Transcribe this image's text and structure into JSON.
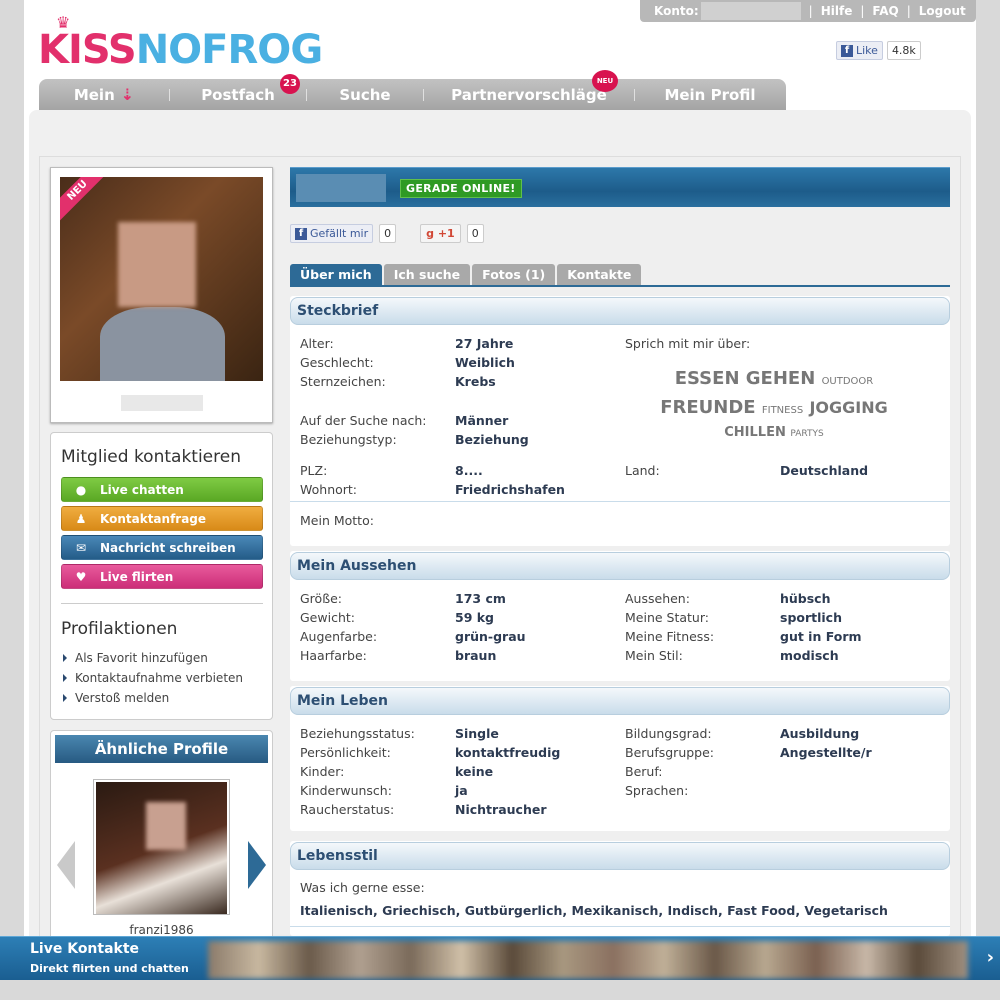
{
  "topbar": {
    "konto": "Konto:",
    "help": "Hilfe",
    "faq": "FAQ",
    "logout": "Logout"
  },
  "logo": {
    "kiss": "KISS",
    "nofrog": "NOFROG"
  },
  "facebook": {
    "like": "Like",
    "count": "4.8k"
  },
  "nav": {
    "items": [
      {
        "label": "Mein"
      },
      {
        "label": "Postfach",
        "badge": "23"
      },
      {
        "label": "Suche"
      },
      {
        "label": "Partnervorschläge",
        "badge": "NEU"
      },
      {
        "label": "Mein Profil"
      }
    ]
  },
  "profile": {
    "neu_ribbon": "NEU",
    "online_badge": "GERADE ONLINE!"
  },
  "social": {
    "fb_like": "Gefällt mir",
    "fb_count": "0",
    "gplus": "+1",
    "gplus_count": "0"
  },
  "contact": {
    "title": "Mitglied kontaktieren",
    "buttons": [
      {
        "label": "Live chatten",
        "color": "#6ab82e"
      },
      {
        "label": "Kontaktanfrage",
        "color": "#e09a2c"
      },
      {
        "label": "Nachricht schreiben",
        "color": "#2d6a96"
      },
      {
        "label": "Live flirten",
        "color": "#d93b86"
      }
    ],
    "actions_title": "Profilaktionen",
    "actions": [
      "Als Favorit hinzufügen",
      "Kontaktaufnahme verbieten",
      "Verstoß melden"
    ]
  },
  "similar": {
    "title": "Ähnliche Profile",
    "name": "franzi1986"
  },
  "tabs": [
    "Über mich",
    "Ich suche",
    "Fotos (1)",
    "Kontakte"
  ],
  "steckbrief": {
    "title": "Steckbrief",
    "alter_l": "Alter:",
    "alter_v": "27 Jahre",
    "geschlecht_l": "Geschlecht:",
    "geschlecht_v": "Weiblich",
    "stern_l": "Sternzeichen:",
    "stern_v": "Krebs",
    "suche_l": "Auf der Suche nach:",
    "suche_v": "Männer",
    "bez_l": "Beziehungstyp:",
    "bez_v": "Beziehung",
    "plz_l": "PLZ:",
    "plz_v": "8....",
    "wohn_l": "Wohnort:",
    "wohn_v": "Friedrichshafen",
    "land_l": "Land:",
    "land_v": "Deutschland",
    "sprich_l": "Sprich mit mir über:",
    "motto_l": "Mein Motto:",
    "cloud": {
      "essen": "ESSEN GEHEN",
      "outdoor": "OUTDOOR",
      "freunde": "FREUNDE",
      "fitness": "FITNESS",
      "jogging": "JOGGING",
      "chillen": "CHILLEN",
      "partys": "PARTYS"
    }
  },
  "aussehen": {
    "title": "Mein Aussehen",
    "groesse_l": "Größe:",
    "groesse_v": "173 cm",
    "gewicht_l": "Gewicht:",
    "gewicht_v": "59 kg",
    "augen_l": "Augenfarbe:",
    "augen_v": "grün-grau",
    "haar_l": "Haarfarbe:",
    "haar_v": "braun",
    "aussehen_l": "Aussehen:",
    "aussehen_v": "hübsch",
    "statur_l": "Meine Statur:",
    "statur_v": "sportlich",
    "fitness_l": "Meine Fitness:",
    "fitness_v": "gut in Form",
    "stil_l": "Mein Stil:",
    "stil_v": "modisch"
  },
  "leben": {
    "title": "Mein Leben",
    "status_l": "Beziehungsstatus:",
    "status_v": "Single",
    "pers_l": "Persönlichkeit:",
    "pers_v": "kontaktfreudig",
    "kinder_l": "Kinder:",
    "kinder_v": "keine",
    "wunsch_l": "Kinderwunsch:",
    "wunsch_v": "ja",
    "raucher_l": "Raucherstatus:",
    "raucher_v": "Nichtraucher",
    "bildung_l": "Bildungsgrad:",
    "bildung_v": "Ausbildung",
    "beruf_grp_l": "Berufsgruppe:",
    "beruf_grp_v": "Angestellte/r",
    "beruf_l": "Beruf:",
    "sprachen_l": "Sprachen:"
  },
  "lebensstil": {
    "title": "Lebensstil",
    "esse_l": "Was ich gerne esse:",
    "esse_v": "Italienisch, Griechisch, Gutbürgerlich, Mexikanisch, Indisch, Fast Food, Vegetarisch"
  },
  "live": {
    "title": "Live Kontakte",
    "subtitle": "Direkt flirten und chatten",
    "arrow": "›"
  }
}
